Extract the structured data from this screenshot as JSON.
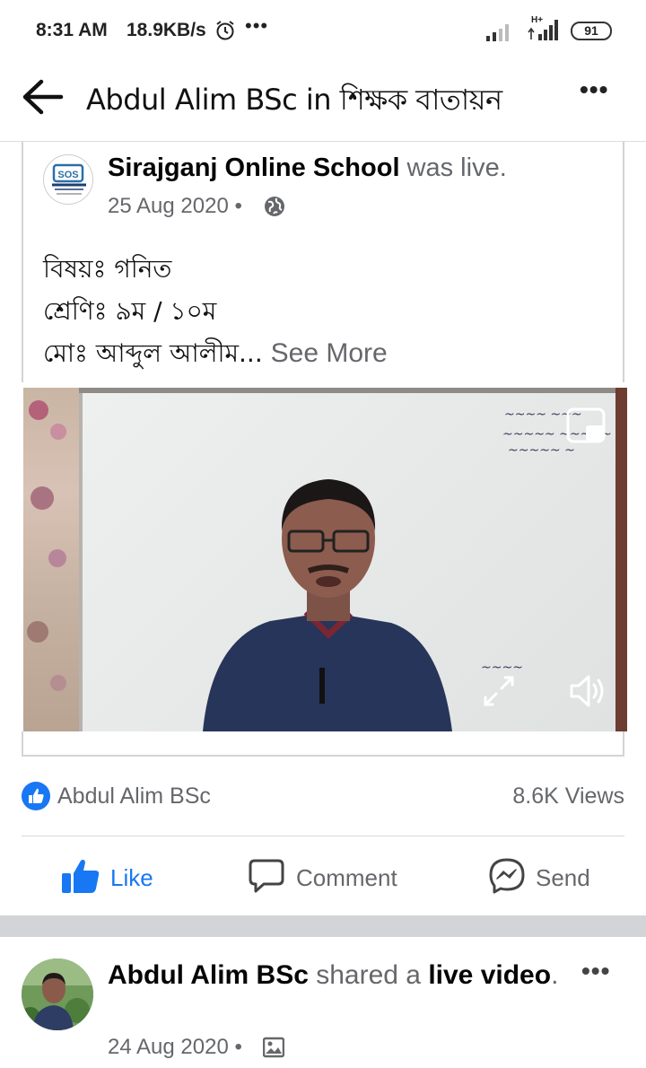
{
  "status_bar": {
    "time": "8:31 AM",
    "speed": "18.9KB/s",
    "overflow": "•••",
    "network": "H+",
    "battery": "91",
    "icons": [
      "alarm-icon",
      "signal-icon",
      "battery-icon"
    ]
  },
  "header": {
    "title": "Abdul Alim BSc in শিক্ষক বাতায়ন",
    "more": "•••"
  },
  "shared_post": {
    "page_name": "Sirajganj Online School",
    "action": " was live.",
    "avatar_text": "SOS",
    "date": "25 Aug 2020",
    "separator": "•",
    "lines": [
      "বিষয়ঃ গনিত",
      "শ্রেণিঃ ৯ম / ১০ম",
      "মোঃ আব্দুল আলীম..."
    ],
    "see_more": "See More"
  },
  "stats": {
    "reactor": "Abdul Alim BSc",
    "views": "8.6K Views"
  },
  "actions": {
    "like": "Like",
    "comment": "Comment",
    "send": "Send"
  },
  "next_post": {
    "name": "Abdul Alim BSc",
    "shared": " shared a ",
    "object": "live video",
    "period": ".",
    "date": "24 Aug 2020",
    "separator": "•",
    "more": "•••"
  },
  "colors": {
    "accent": "#1877f2",
    "secondary_text": "#65676b",
    "divider": "#d3d4d8"
  }
}
